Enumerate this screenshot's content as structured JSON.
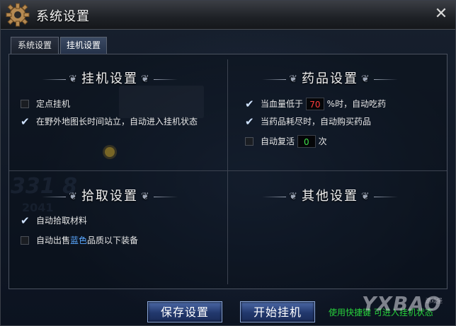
{
  "window": {
    "title": "系统设置",
    "close_label": "✕"
  },
  "tabs": [
    {
      "label": "系统设置",
      "active": false
    },
    {
      "label": "挂机设置",
      "active": true
    }
  ],
  "sections": {
    "afk": {
      "title": "挂机设置",
      "options": [
        {
          "label": "定点挂机",
          "checked": false
        },
        {
          "label": "在野外地图长时间站立，自动进入挂机状态",
          "checked": true
        }
      ]
    },
    "potion": {
      "title": "药品设置",
      "hp_prefix": "当血量低于",
      "hp_value": "70",
      "hp_suffix": "%时，自动吃药",
      "hp_checked": true,
      "buy_label": "当药品耗尽时，自动购买药品",
      "buy_checked": true,
      "revive_label": "自动复活",
      "revive_value": "0",
      "revive_suffix": "次",
      "revive_checked": false
    },
    "pickup": {
      "title": "拾取设置",
      "auto_pick_label": "自动拾取材料",
      "auto_pick_checked": true,
      "sell_prefix": "自动出售",
      "sell_color_word": "蓝色",
      "sell_suffix": "品质以下装备",
      "sell_checked": false
    },
    "other": {
      "title": "其他设置"
    }
  },
  "buttons": {
    "save": "保存设置",
    "start": "开始挂机"
  },
  "hint": "使用快捷键  可进入挂机状态",
  "watermark": {
    "brand": "YXBAO",
    "sub": "游戏堡"
  },
  "colors": {
    "hint_green": "#27d13b",
    "blue_quality": "#5aa8ff",
    "hp_value_red": "#ff3b3b",
    "revive_value_green": "#3fe04a"
  }
}
